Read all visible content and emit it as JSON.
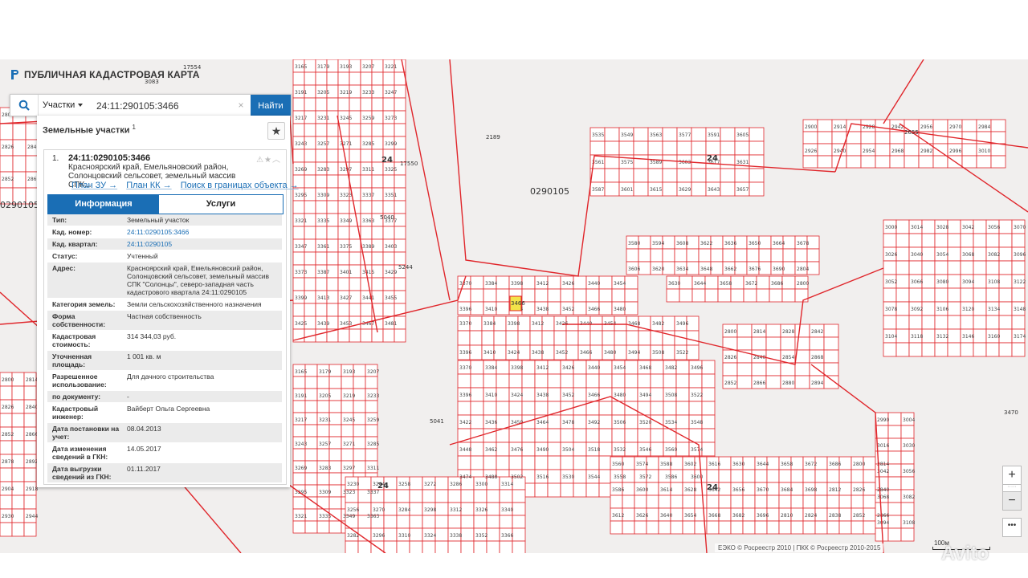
{
  "app": {
    "title": "ПУБЛИЧНАЯ КАДАСТРОВАЯ КАРТА"
  },
  "search": {
    "type_label": "Участки",
    "query": "24:11:290105:3466",
    "clear": "×",
    "button": "Найти"
  },
  "panel": {
    "header": "Земельные участки",
    "count": "1",
    "star": "★",
    "item": {
      "index": "1.",
      "cad_number": "24:11:0290105:3466",
      "address_short": "Красноярский край, Емельяновский район, Солонцовский сельсовет, земельный массив СПК...",
      "tools": "⚠★︿",
      "links": [
        "План ЗУ →",
        "План КК →",
        "Поиск в границах объекта →"
      ]
    },
    "tabs": [
      "Информация",
      "Услуги"
    ],
    "rows": [
      {
        "k": "Тип:",
        "v": "Земельный участок"
      },
      {
        "k": "Кад. номер:",
        "v": "24:11:0290105:3466"
      },
      {
        "k": "Кад. квартал:",
        "v": "24:11:0290105"
      },
      {
        "k": "Статус:",
        "v": "Учтенный"
      },
      {
        "k": "Адрес:",
        "v": "Красноярский край, Емельяновский район, Солонцовский сельсовет, земельный массив СПК \"Солонцы\", северо-западная часть кадастрового квартала 24:11:0290105"
      },
      {
        "k": "Категория земель:",
        "v": "Земли сельскохозяйственного назначения"
      },
      {
        "k": "Форма собственности:",
        "v": "Частная собственность"
      },
      {
        "k": "Кадастровая стоимость:",
        "v": "314 344,03 руб."
      },
      {
        "k": "Уточненная площадь:",
        "v": "1 001 кв. м"
      },
      {
        "k": "Разрешенное использование:",
        "v": "Для дачного строительства"
      },
      {
        "k": "по документу:",
        "v": "-"
      },
      {
        "k": "Кадастровый инженер:",
        "v": "Вайберт Ольга Сергеевна"
      },
      {
        "k": "Дата постановки на учет:",
        "v": "08.04.2013"
      },
      {
        "k": "Дата изменения сведений в ГКН:",
        "v": "14.05.2017"
      },
      {
        "k": "Дата выгрузки сведений из ГКН:",
        "v": "01.11.2017"
      }
    ]
  },
  "map": {
    "labels": [
      {
        "text": "0290105",
        "size": "big"
      },
      {
        "text": "0290105",
        "size": "big"
      },
      {
        "text": "24",
        "size": "bold"
      },
      {
        "text": "24",
        "size": "bold"
      },
      {
        "text": "24",
        "size": "bold"
      },
      {
        "text": "24",
        "size": "bold"
      },
      {
        "text": "2189",
        "size": "small"
      },
      {
        "text": "17550",
        "size": "small"
      },
      {
        "text": "17554",
        "size": "small"
      },
      {
        "text": "5040",
        "size": "small"
      },
      {
        "text": "5244",
        "size": "small"
      },
      {
        "text": "5041",
        "size": "small"
      },
      {
        "text": "3470",
        "size": "small"
      },
      {
        "text": "2655",
        "size": "small"
      },
      {
        "text": "3083",
        "size": "small"
      },
      {
        "text": "3466",
        "size": "small"
      }
    ],
    "zoom_in": "+",
    "zoom_out": "−",
    "more": "•••",
    "scale": "100м",
    "copyright": "ЕЭКО © Росреестр 2010 | ПКК © Росреестр 2010-2015",
    "watermark": "Avito",
    "parcel_color": "#e0262b",
    "highlight_color": "#f3e34a"
  }
}
